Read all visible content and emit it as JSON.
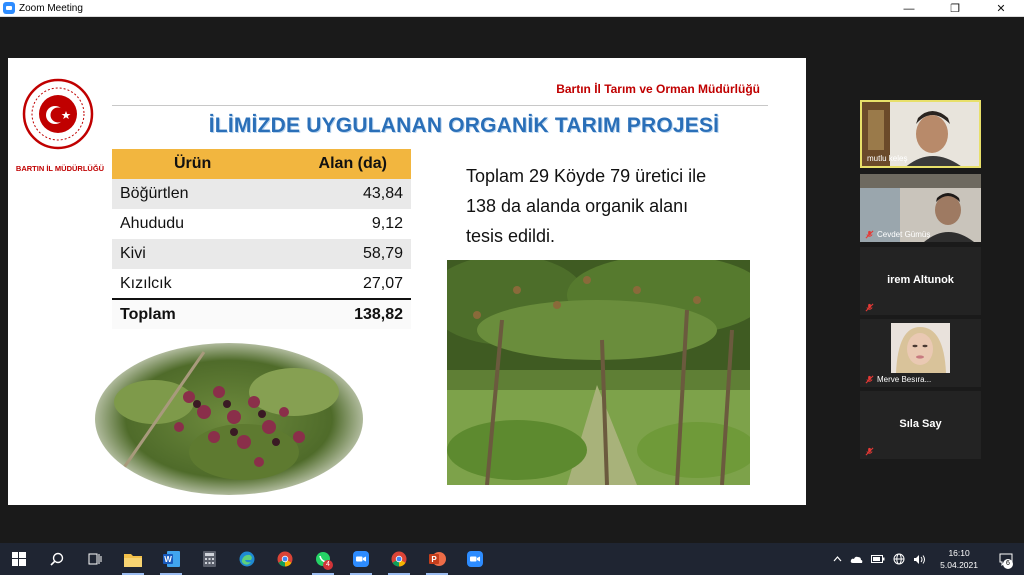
{
  "window": {
    "title": "Zoom Meeting",
    "controls": {
      "minimize": "—",
      "maximize": "❐",
      "close": "✕"
    }
  },
  "slide": {
    "org_name": "Bartın İl Tarım ve Orman Müdürlüğü",
    "logo_caption": "BARTIN İL MÜDÜRLÜĞÜ",
    "title": "İLİMİZDE UYGULANAN ORGANİK TARIM PROJESİ",
    "table": {
      "headers": [
        "Ürün",
        "Alan (da)"
      ],
      "rows": [
        {
          "product": "Böğürtlen",
          "area": "43,84"
        },
        {
          "product": "Ahududu",
          "area": "9,12"
        },
        {
          "product": "Kivi",
          "area": "58,79"
        },
        {
          "product": "Kızılcık",
          "area": "27,07"
        }
      ],
      "total": {
        "label": "Toplam",
        "value": "138,82"
      }
    },
    "summary_lines": [
      "Toplam 29 Köyde 79 üretici ile",
      "138 da alanda organik alanı",
      "tesis edildi."
    ]
  },
  "participants": [
    {
      "name": "mutlu keleş",
      "video": true,
      "active": true,
      "muted": false
    },
    {
      "name": "Cevdet Gümüş",
      "video": true,
      "active": false,
      "muted": true
    },
    {
      "name": "irem Altunok",
      "video": false,
      "active": false,
      "muted": true
    },
    {
      "name": "Merve Besıra...",
      "video": true,
      "active": false,
      "muted": true
    },
    {
      "name": "Sıla Say",
      "video": false,
      "active": false,
      "muted": true
    }
  ],
  "taskbar": {
    "whatsapp_badge": "4",
    "clock_time": "16:10",
    "clock_date": "5.04.2021",
    "notifications_count": "6"
  },
  "colors": {
    "zoom_blue": "#2d8cff",
    "slide_red": "#c00000",
    "title_blue": "#2a6fb8",
    "table_header": "#f2b63f",
    "active_speaker": "#e8e06a",
    "taskbar": "#1f2532"
  }
}
